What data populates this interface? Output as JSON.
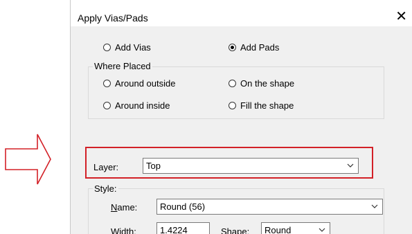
{
  "dialog": {
    "title": "Apply Vias/Pads",
    "close_glyph": "✕"
  },
  "mode": {
    "add_vias_label": "Add Vias",
    "add_pads_label": "Add Pads",
    "selected": "add_pads"
  },
  "where_placed": {
    "legend": "Where Placed",
    "around_outside_label": "Around outside",
    "on_the_shape_label": "On the shape",
    "around_inside_label": "Around inside",
    "fill_the_shape_label": "Fill the shape"
  },
  "layer": {
    "label": "Layer:",
    "value": "Top"
  },
  "style": {
    "legend": "Style:",
    "name_label_first": "N",
    "name_label_rest": "ame:",
    "name_value": "Round (56)",
    "width_label": "Width:",
    "width_value": "1.4224",
    "shape_label": "Shape:",
    "shape_value": "Round"
  },
  "colors": {
    "highlight": "#d32027",
    "callout_arrow": "#d32027"
  }
}
